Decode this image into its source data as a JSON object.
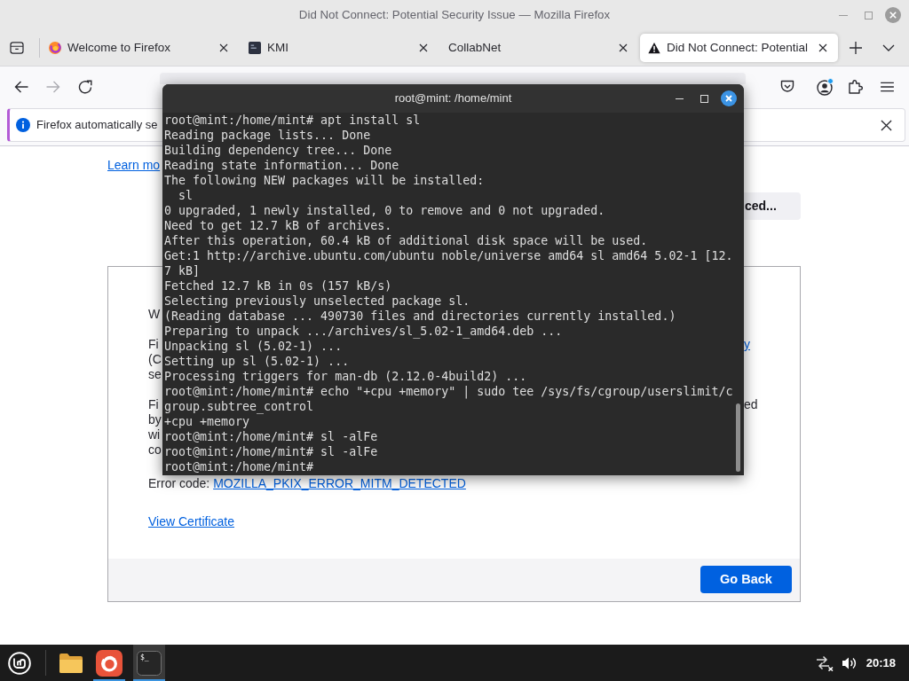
{
  "window": {
    "title": "Did Not Connect: Potential Security Issue — Mozilla Firefox"
  },
  "tabs": [
    {
      "label": "Welcome to Firefox",
      "kind": "round",
      "selected": false
    },
    {
      "label": "KMI",
      "kind": "square",
      "selected": false
    },
    {
      "label": "CollabNet",
      "kind": "plain",
      "selected": false
    },
    {
      "label": "Did Not Connect: Potential",
      "kind": "warning",
      "selected": true
    }
  ],
  "nav_buttons": [
    {
      "kind": "back",
      "disabled": false
    },
    {
      "kind": "forward",
      "disabled": true
    },
    {
      "kind": "reload",
      "disabled": false
    }
  ],
  "notification": {
    "text": "Firefox automatically se"
  },
  "page": {
    "learn_more": "Learn mo",
    "advanced_button": "ced...",
    "card": {
      "paragraphs": [
        {
          "lines": [
            {
              "left": "W"
            }
          ]
        },
        {
          "lines": [
            {
              "left": "Fi",
              "right": {
                "text": "y",
                "kind": "link"
              }
            },
            {
              "left": "(C"
            },
            {
              "left": "se"
            }
          ]
        },
        {
          "lines": [
            {
              "left": "Fi",
              "right": {
                "text": "ed",
                "kind": "text"
              }
            },
            {
              "left": "by"
            },
            {
              "left": "wi"
            },
            {
              "left": "co"
            }
          ]
        }
      ],
      "error_label": "Error code:",
      "error_code": "MOZILLA_PKIX_ERROR_MITM_DETECTED",
      "certificate_link": "View Certificate",
      "back_button": "Go Back"
    }
  },
  "terminal": {
    "title": "root@mint: /home/mint",
    "lines": [
      "root@mint:/home/mint# apt install sl",
      "Reading package lists... Done",
      "Building dependency tree... Done",
      "Reading state information... Done",
      "The following NEW packages will be installed:",
      "  sl",
      "0 upgraded, 1 newly installed, 0 to remove and 0 not upgraded.",
      "Need to get 12.7 kB of archives.",
      "After this operation, 60.4 kB of additional disk space will be used.",
      "Get:1 http://archive.ubuntu.com/ubuntu noble/universe amd64 sl amd64 5.02-1 [12.",
      "7 kB]",
      "Fetched 12.7 kB in 0s (157 kB/s)",
      "Selecting previously unselected package sl.",
      "(Reading database ... 490730 files and directories currently installed.)",
      "Preparing to unpack .../archives/sl_5.02-1_amd64.deb ...",
      "Unpacking sl (5.02-1) ...",
      "Setting up sl (5.02-1) ...",
      "Processing triggers for man-db (2.12.0-4build2) ...",
      "root@mint:/home/mint# echo \"+cpu +memory\" | sudo tee /sys/fs/cgroup/userslimit/c",
      "group.subtree_control",
      "+cpu +memory",
      "root@mint:/home/mint# sl -alFe",
      "root@mint:/home/mint# sl -alFe",
      "root@mint:/home/mint#"
    ]
  },
  "taskbar": {
    "apps": [
      {
        "kind": "folder",
        "running": false,
        "active": false
      },
      {
        "kind": "browser",
        "running": true,
        "active": false
      },
      {
        "kind": "terminal",
        "glyph": "$_",
        "running": true,
        "active": true
      }
    ],
    "clock": "20:18"
  }
}
